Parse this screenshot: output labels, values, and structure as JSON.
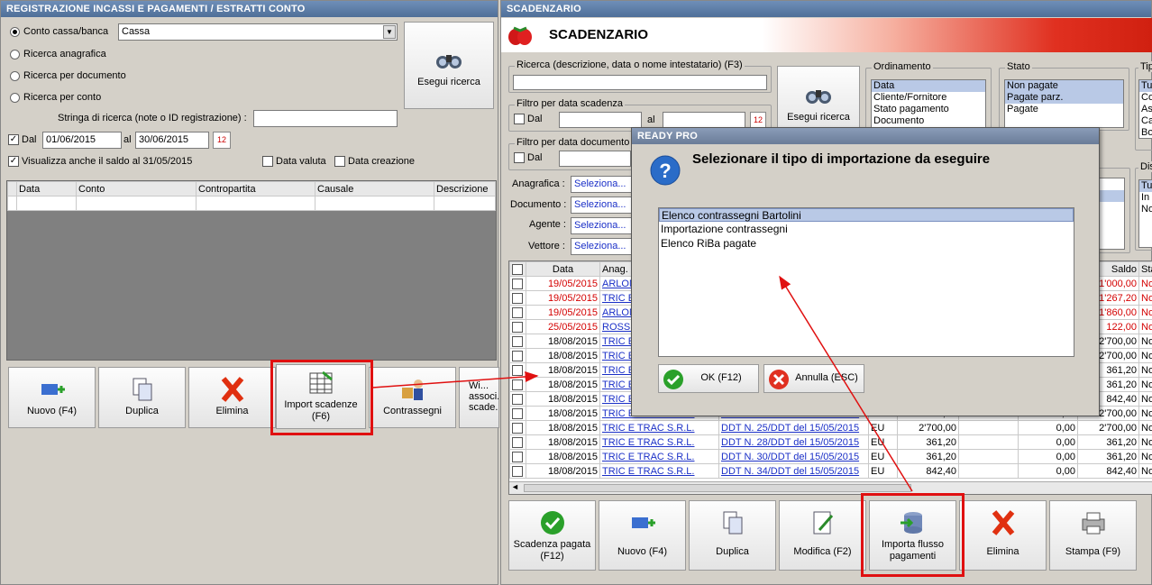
{
  "left": {
    "title": "REGISTRAZIONE INCASSI E PAGAMENTI / ESTRATTI CONTO",
    "radios": [
      "Conto cassa/banca",
      "Ricerca anagrafica",
      "Ricerca per documento",
      "Ricerca per conto"
    ],
    "cassa_value": "Cassa",
    "search_btn": "Esegui ricerca",
    "search_string_label": "Stringa di ricerca (note o ID registrazione) :",
    "dal_label": "Dal",
    "dal_value": "01/06/2015",
    "al_label": "al",
    "al_value": "30/06/2015",
    "saldo_label": "Visualizza anche il saldo al 31/05/2015",
    "data_valuta": "Data valuta",
    "data_creazione": "Data creazione",
    "columns": [
      "Data",
      "Conto",
      "Contropartita",
      "Causale",
      "Descrizione"
    ],
    "buttons": [
      "Nuovo (F4)",
      "Duplica",
      "Elimina",
      "Import scadenze (F6)",
      "Contrassegni",
      "Wi... associ... scade..."
    ]
  },
  "right": {
    "title": "SCADENZARIO",
    "header": "SCADENZARIO",
    "ricerca_label": "Ricerca (descrizione, data o nome intestatario) (F3)",
    "filtro_scad": "Filtro per data scadenza",
    "filtro_doc": "Filtro per data documento",
    "dal": "Dal",
    "al": "al",
    "search_btn": "Esegui ricerca",
    "ordinamento": {
      "label": "Ordinamento",
      "items": [
        "Data",
        "Cliente/Fornitore",
        "Stato pagamento",
        "Documento"
      ]
    },
    "stato": {
      "label": "Stato",
      "items": [
        "Non pagate",
        "Pagate parz.",
        "Pagate"
      ]
    },
    "tipo": {
      "label": "Tip",
      "items": [
        "Tu",
        "Co",
        "As",
        "Ca",
        "Bo"
      ]
    },
    "dis": {
      "label": "Dis",
      "items": [
        "Tu",
        "In",
        "No"
      ]
    },
    "filters": [
      {
        "label": "Anagrafica :",
        "value": "Seleziona..."
      },
      {
        "label": "Documento :",
        "value": "Seleziona..."
      },
      {
        "label": "Agente :",
        "value": "Seleziona..."
      },
      {
        "label": "Vettore :",
        "value": "Seleziona..."
      }
    ],
    "columns": [
      "Data",
      "Anag.",
      "Saldo",
      "Sta"
    ],
    "rows": [
      {
        "data": "19/05/2015",
        "anag": "ARLONI",
        "doc": "",
        "val": "",
        "imp": "",
        "pag": "",
        "saldo": "1'000,00",
        "sta": "No",
        "red": true
      },
      {
        "data": "19/05/2015",
        "anag": "TRIC E",
        "doc": "",
        "val": "",
        "imp": "",
        "pag": "",
        "saldo": "1'267,20",
        "sta": "No",
        "red": true
      },
      {
        "data": "19/05/2015",
        "anag": "ARLONI",
        "doc": "",
        "val": "",
        "imp": "",
        "pag": "",
        "saldo": "1'860,00",
        "sta": "No",
        "red": true
      },
      {
        "data": "25/05/2015",
        "anag": "ROSSI I",
        "doc": "",
        "val": "",
        "imp": "",
        "pag": "",
        "saldo": "122,00",
        "sta": "No",
        "red": true
      },
      {
        "data": "18/08/2015",
        "anag": "TRIC E",
        "doc": "",
        "val": "",
        "imp": "",
        "pag": "",
        "saldo": "2'700,00",
        "sta": "No",
        "red": false
      },
      {
        "data": "18/08/2015",
        "anag": "TRIC E",
        "doc": "",
        "val": "",
        "imp": "",
        "pag": "",
        "saldo": "2'700,00",
        "sta": "No",
        "red": false
      },
      {
        "data": "18/08/2015",
        "anag": "TRIC E",
        "doc": "",
        "val": "",
        "imp": "",
        "pag": "",
        "saldo": "361,20",
        "sta": "No",
        "red": false
      },
      {
        "data": "18/08/2015",
        "anag": "TRIC E",
        "doc": "",
        "val": "",
        "imp": "",
        "pag": "",
        "saldo": "361,20",
        "sta": "No",
        "red": false
      },
      {
        "data": "18/08/2015",
        "anag": "TRIC E",
        "doc": "",
        "val": "",
        "imp": "",
        "pag": "",
        "saldo": "842,40",
        "sta": "No",
        "red": false
      },
      {
        "data": "18/08/2015",
        "anag": "TRIC E TRAC S.R.L.",
        "doc": "DDT N. 23/DDT del 15/05/2015",
        "val": "EU",
        "imp": "2'700,00",
        "pag": "0,00",
        "saldo": "2'700,00",
        "sta": "No",
        "red": false
      },
      {
        "data": "18/08/2015",
        "anag": "TRIC E TRAC S.R.L.",
        "doc": "DDT N. 25/DDT del 15/05/2015",
        "val": "EU",
        "imp": "2'700,00",
        "pag": "0,00",
        "saldo": "2'700,00",
        "sta": "No",
        "red": false
      },
      {
        "data": "18/08/2015",
        "anag": "TRIC E TRAC S.R.L.",
        "doc": "DDT N. 28/DDT del 15/05/2015",
        "val": "EU",
        "imp": "361,20",
        "pag": "0,00",
        "saldo": "361,20",
        "sta": "No",
        "red": false
      },
      {
        "data": "18/08/2015",
        "anag": "TRIC E TRAC S.R.L.",
        "doc": "DDT N. 30/DDT del 15/05/2015",
        "val": "EU",
        "imp": "361,20",
        "pag": "0,00",
        "saldo": "361,20",
        "sta": "No",
        "red": false
      },
      {
        "data": "18/08/2015",
        "anag": "TRIC E TRAC S.R.L.",
        "doc": "DDT N. 34/DDT del 15/05/2015",
        "val": "EU",
        "imp": "842,40",
        "pag": "0,00",
        "saldo": "842,40",
        "sta": "No",
        "red": false
      }
    ],
    "buttons": [
      "Scadenza pagata (F12)",
      "Nuovo (F4)",
      "Duplica",
      "Modifica (F2)",
      "Importa flusso pagamenti",
      "Elimina",
      "Stampa (F9)"
    ]
  },
  "dialog": {
    "title": "READY PRO",
    "question": "Selezionare il tipo di importazione da eseguire",
    "options": [
      "Elenco contrassegni Bartolini",
      "Importazione contrassegni",
      "Elenco RiBa pagate"
    ],
    "ok": "OK (F12)",
    "cancel": "Annulla (ESC)"
  }
}
